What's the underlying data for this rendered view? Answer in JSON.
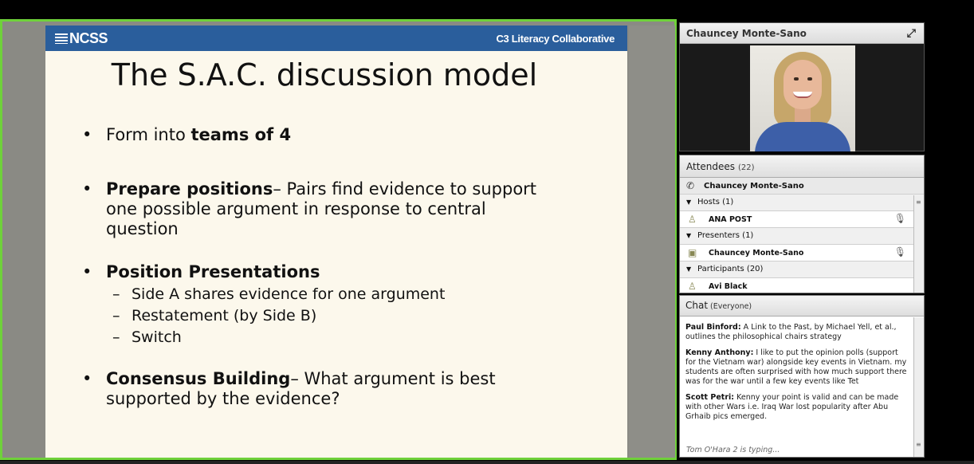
{
  "slide": {
    "logo_text": "NCSS",
    "partner_text": "C3 Literacy Collaborative",
    "title": "The S.A.C. discussion model",
    "bullet_char": "•",
    "dash_char": "–",
    "b1_pre": "Form into ",
    "b1_bold": "teams of 4",
    "b2_bold": "Prepare positions",
    "b2_rest": "– Pairs find evidence to support one possible argument in response to central question",
    "b3_bold": "Position Presentations",
    "subs": [
      "Side A shares evidence for one argument",
      "Restatement (by Side B)",
      "Switch"
    ],
    "b4_bold": "Consensus Building",
    "b4_rest": "– What argument is best supported by the evidence?"
  },
  "video": {
    "presenter_name": "Chauncey Monte-Sano",
    "fullscreen_icon": "expand-icon"
  },
  "attendees": {
    "title": "Attendees",
    "count": "(22)",
    "me": "Chauncey Monte-Sano",
    "hosts_label": "Hosts (1)",
    "host_1": "ANA POST",
    "presenters_label": "Presenters (1)",
    "presenter_1": "Chauncey Monte-Sano",
    "participants_label": "Participants (20)",
    "participant_1": "Avi Black"
  },
  "chat": {
    "title": "Chat",
    "scope": "(Everyone)",
    "messages": [
      {
        "author": "Paul Binford:",
        "text": " A Link to the Past, by Michael Yell, et al., outlines the philosophical chairs strategy"
      },
      {
        "author": "Kenny Anthony:",
        "text": " I like to put the opinion polls (support for the Vietnam war) alongside key events in Vietnam. my students are often surprised with how much support there was for the war until a few key events like Tet"
      },
      {
        "author": "Scott Petri:",
        "text": " Kenny your point is valid and can be made with other Wars i.e. Iraq War lost popularity after Abu Grhaib pics emerged."
      }
    ],
    "typing": "Tom O'Hara 2 is typing..."
  },
  "colors": {
    "active_border": "#6fd13a",
    "slide_header": "#2a5e9c",
    "slide_bg": "#fcf8ec"
  }
}
